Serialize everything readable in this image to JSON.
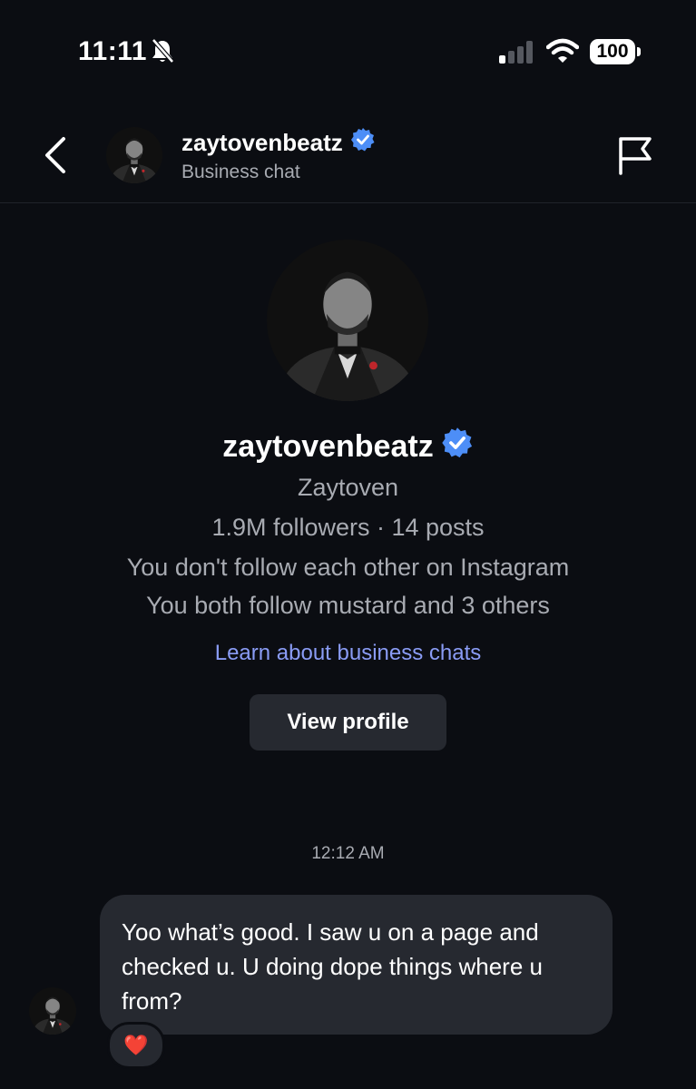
{
  "status_bar": {
    "time": "11:11",
    "battery": "100",
    "icons": [
      "bell-slash-icon",
      "cellular-signal-icon",
      "wifi-icon",
      "battery-icon"
    ]
  },
  "header": {
    "username": "zaytovenbeatz",
    "subtitle": "Business chat",
    "verified": true,
    "icons": [
      "chevron-left-icon",
      "verified-badge-icon",
      "flag-icon"
    ]
  },
  "profile": {
    "username": "zaytovenbeatz",
    "full_name": "Zaytoven",
    "stats": "1.9M followers · 14 posts",
    "follow_status": "You don't follow each other on Instagram",
    "mutual": "You both follow mustard and 3 others",
    "learn_link": "Learn about business chats",
    "view_profile_label": "View profile"
  },
  "messages": [
    {
      "timestamp": "12:12 AM",
      "text": "Yoo what’s good. I saw u on a page and checked u. U doing dope things where u from?",
      "reaction": "❤️"
    }
  ],
  "colors": {
    "background": "#0b0d12",
    "bubble": "#262930",
    "secondary_text": "#a8abb2",
    "link": "#8a9cf5",
    "verified": "#4d8ef7"
  }
}
